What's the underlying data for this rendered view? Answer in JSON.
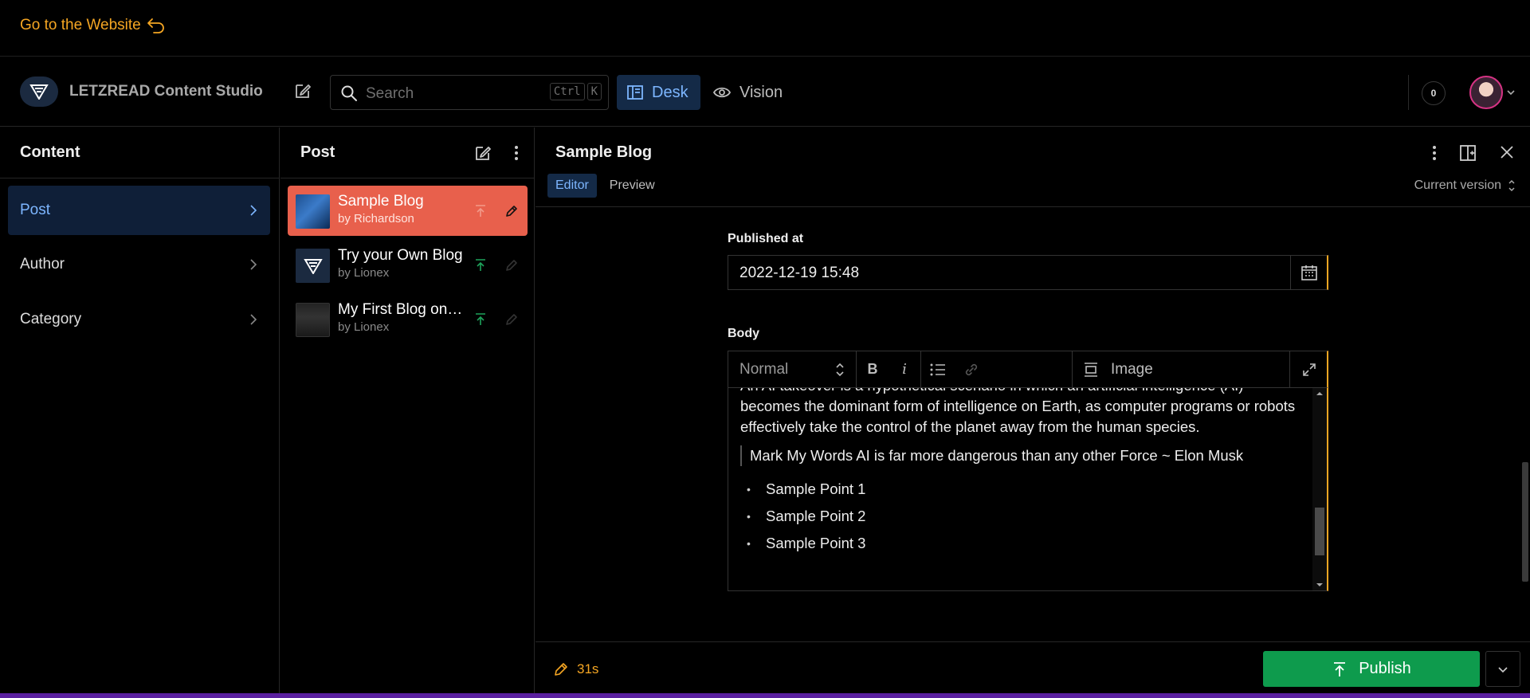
{
  "top_link": {
    "label": "Go to the Website"
  },
  "navbar": {
    "brand": "LETZREAD Content Studio",
    "search_placeholder": "Search",
    "search_shortcut": [
      "Ctrl",
      "K"
    ],
    "tabs": [
      {
        "label": "Desk",
        "icon": "desk-icon",
        "active": true
      },
      {
        "label": "Vision",
        "icon": "eye-icon",
        "active": false
      }
    ],
    "notification_count": "0"
  },
  "content_pane": {
    "title": "Content",
    "items": [
      {
        "label": "Post",
        "selected": true
      },
      {
        "label": "Author",
        "selected": false
      },
      {
        "label": "Category",
        "selected": false
      }
    ]
  },
  "post_pane": {
    "title": "Post",
    "documents": [
      {
        "title": "Sample Blog",
        "subtitle": "by Richardson",
        "selected": true
      },
      {
        "title": "Try your Own Blog",
        "subtitle": "by Lionex",
        "selected": false
      },
      {
        "title": "My First Blog on Sanity",
        "subtitle": "by Lionex",
        "selected": false
      }
    ]
  },
  "document": {
    "title": "Sample Blog",
    "view_tabs": [
      {
        "label": "Editor",
        "active": true
      },
      {
        "label": "Preview",
        "active": false
      }
    ],
    "version": "Current version",
    "published_at": {
      "label": "Published at",
      "value": "2022-12-19 15:48"
    },
    "body": {
      "label": "Body",
      "style_select": "Normal",
      "toolbar": {
        "bold": "B",
        "italic": "i",
        "insert": "Image"
      },
      "paragraph": "An AI takeover is a hypothetical scenario in which an artificial intelligence (AI) becomes the dominant form of intelligence on Earth, as computer programs or robots effectively take the control of the planet away from the human species.",
      "quote": "Mark My Words AI is far more dangerous than any other Force ~ Elon Musk",
      "list": [
        "Sample Point 1",
        "Sample Point 2",
        "Sample Point 3"
      ]
    },
    "footer": {
      "status": "31s",
      "publish_label": "Publish"
    }
  },
  "colors": {
    "accent_orange": "#f5a623",
    "selected_doc": "#e8604c",
    "publish_green": "#0e9b4d",
    "selection_blue": "#7db6ff"
  }
}
